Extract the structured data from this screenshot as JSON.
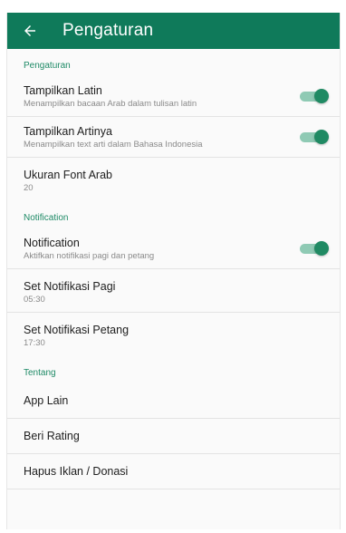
{
  "appbar": {
    "title": "Pengaturan",
    "back_icon": "arrow-left-icon"
  },
  "colors": {
    "accent": "#0f7a5a",
    "section": "#1e8a66",
    "toggle_thumb": "#208a63",
    "toggle_track": "#8fcab4"
  },
  "sections": {
    "pengaturan": {
      "header": "Pengaturan",
      "tampilkan_latin": {
        "title": "Tampilkan Latin",
        "subtitle": "Menampilkan bacaan Arab dalam tulisan latin",
        "enabled": true
      },
      "tampilkan_artinya": {
        "title": "Tampilkan Artinya",
        "subtitle": "Menampilkan text arti dalam Bahasa Indonesia",
        "enabled": true
      },
      "ukuran_font": {
        "title": "Ukuran Font Arab",
        "value": "20"
      }
    },
    "notification": {
      "header": "Notification",
      "notification": {
        "title": "Notification",
        "subtitle": "Aktifkan notifikasi pagi dan petang",
        "enabled": true
      },
      "pagi": {
        "title": "Set Notifikasi Pagi",
        "value": "05:30"
      },
      "petang": {
        "title": "Set Notifikasi Petang",
        "value": "17:30"
      }
    },
    "tentang": {
      "header": "Tentang",
      "app_lain": "App Lain",
      "beri_rating": "Beri Rating",
      "hapus_iklan": "Hapus Iklan / Donasi"
    }
  }
}
